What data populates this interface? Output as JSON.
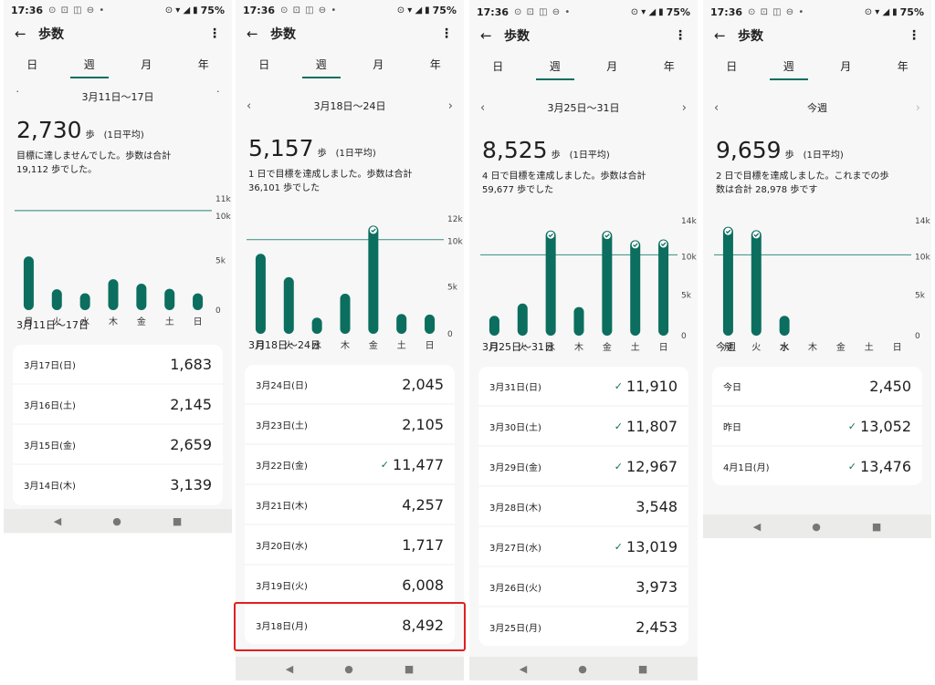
{
  "status": {
    "time": "17:36",
    "battery": "75%"
  },
  "appbar": {
    "title": "歩数",
    "back_icon": "arrow-left-icon",
    "more_icon": "more-vert-icon"
  },
  "tabs": [
    "日",
    "週",
    "月",
    "年"
  ],
  "navbar": {
    "back": "◀",
    "home": "●",
    "recents": "■"
  },
  "chart_data": [
    {
      "type": "bar",
      "categories": [
        "月",
        "火",
        "水",
        "木",
        "金",
        "土",
        "日"
      ],
      "values": [
        8492,
        6008,
        1717,
        4257,
        11477,
        2105,
        2045
      ],
      "ylim": [
        0,
        12000
      ],
      "yticks": [
        "12k",
        "10k",
        "5k",
        "0"
      ],
      "goal": 10000,
      "goal_met": [
        false,
        false,
        false,
        false,
        true,
        false,
        false
      ]
    }
  ],
  "screens": [
    {
      "period_label": "3月11日～17日",
      "average": "2,730",
      "unit": "歩",
      "avg_note": "(1日平均)",
      "summary": [
        "目標に達しませんでした。歩数は合計",
        "19,112 歩でした。"
      ],
      "yticks": [
        "11k",
        "10k",
        "5k",
        "0"
      ],
      "ymax": 11000,
      "goal": 10000,
      "bars": [
        {
          "day": "月",
          "value": 5400,
          "met": false
        },
        {
          "day": "火",
          "value": 2100,
          "met": false
        },
        {
          "day": "水",
          "value": 1700,
          "met": false
        },
        {
          "day": "木",
          "value": 3100,
          "met": false
        },
        {
          "day": "金",
          "value": 2659,
          "met": false
        },
        {
          "day": "土",
          "value": 2145,
          "met": false
        },
        {
          "day": "日",
          "value": 1683,
          "met": false
        }
      ],
      "section_title": "3月11日～17日",
      "rows": [
        {
          "label": "3月17日(日)",
          "value": "1,683",
          "check": ""
        },
        {
          "label": "3月16日(土)",
          "value": "2,145",
          "check": ""
        },
        {
          "label": "3月15日(金)",
          "value": "2,659",
          "check": ""
        },
        {
          "label": "3月14日(木)",
          "value": "3,139",
          "check": ""
        }
      ]
    },
    {
      "period_label": "3月18日～24日",
      "average": "5,157",
      "unit": "歩",
      "avg_note": "(1日平均)",
      "summary": [
        "1 日で目標を達成しました。歩数は合計",
        "36,101 歩でした"
      ],
      "yticks": [
        "12k",
        "10k",
        "5k",
        "0"
      ],
      "ymax": 12000,
      "goal": 10000,
      "bars": [
        {
          "day": "月",
          "value": 8492,
          "met": false
        },
        {
          "day": "火",
          "value": 6008,
          "met": false
        },
        {
          "day": "水",
          "value": 1717,
          "met": false
        },
        {
          "day": "木",
          "value": 4257,
          "met": false
        },
        {
          "day": "金",
          "value": 11477,
          "met": true
        },
        {
          "day": "土",
          "value": 2105,
          "met": false
        },
        {
          "day": "日",
          "value": 2045,
          "met": false
        }
      ],
      "section_title": "3月18日～24日",
      "rows": [
        {
          "label": "3月24日(日)",
          "value": "2,045",
          "check": ""
        },
        {
          "label": "3月23日(土)",
          "value": "2,105",
          "check": ""
        },
        {
          "label": "3月22日(金)",
          "value": "11,477",
          "check": "✓"
        },
        {
          "label": "3月21日(木)",
          "value": "4,257",
          "check": ""
        },
        {
          "label": "3月20日(水)",
          "value": "1,717",
          "check": ""
        },
        {
          "label": "3月19日(火)",
          "value": "6,008",
          "check": ""
        },
        {
          "label": "3月18日(月)",
          "value": "8,492",
          "check": ""
        }
      ]
    },
    {
      "period_label": "3月25日～31日",
      "average": "8,525",
      "unit": "歩",
      "avg_note": "(1日平均)",
      "summary": [
        "4 日で目標を達成しました。歩数は合計",
        "59,677 歩でした"
      ],
      "yticks": [
        "14k",
        "10k",
        "5k",
        "0"
      ],
      "ymax": 14000,
      "goal": 10000,
      "bars": [
        {
          "day": "月",
          "value": 2453,
          "met": false
        },
        {
          "day": "火",
          "value": 3973,
          "met": false
        },
        {
          "day": "水",
          "value": 13019,
          "met": true
        },
        {
          "day": "木",
          "value": 3548,
          "met": false
        },
        {
          "day": "金",
          "value": 12967,
          "met": true
        },
        {
          "day": "土",
          "value": 11807,
          "met": true
        },
        {
          "day": "日",
          "value": 11910,
          "met": true
        }
      ],
      "section_title": "3月25日～31日",
      "rows": [
        {
          "label": "3月31日(日)",
          "value": "11,910",
          "check": "✓"
        },
        {
          "label": "3月30日(土)",
          "value": "11,807",
          "check": "✓"
        },
        {
          "label": "3月29日(金)",
          "value": "12,967",
          "check": "✓"
        },
        {
          "label": "3月28日(木)",
          "value": "3,548",
          "check": ""
        },
        {
          "label": "3月27日(水)",
          "value": "13,019",
          "check": "✓"
        },
        {
          "label": "3月26日(火)",
          "value": "3,973",
          "check": ""
        },
        {
          "label": "3月25日(月)",
          "value": "2,453",
          "check": ""
        }
      ]
    },
    {
      "period_label": "今週",
      "average": "9,659",
      "unit": "歩",
      "avg_note": "(1日平均)",
      "summary": [
        "2 日で目標を達成しました。これまでの歩",
        "数は合計 28,978 歩です"
      ],
      "yticks": [
        "14k",
        "10k",
        "5k",
        "0"
      ],
      "ymax": 14000,
      "goal": 10000,
      "bars": [
        {
          "day": "月",
          "value": 13476,
          "met": true
        },
        {
          "day": "火",
          "value": 13052,
          "met": true
        },
        {
          "day": "水",
          "value": 2450,
          "met": false
        },
        {
          "day": "木",
          "value": 0,
          "met": false
        },
        {
          "day": "金",
          "value": 0,
          "met": false
        },
        {
          "day": "土",
          "value": 0,
          "met": false
        },
        {
          "day": "日",
          "value": 0,
          "met": false
        }
      ],
      "section_title": "今週",
      "rows": [
        {
          "label": "今日",
          "value": "2,450",
          "check": ""
        },
        {
          "label": "昨日",
          "value": "13,052",
          "check": "✓"
        },
        {
          "label": "4月1日(月)",
          "value": "13,476",
          "check": "✓"
        }
      ]
    }
  ]
}
